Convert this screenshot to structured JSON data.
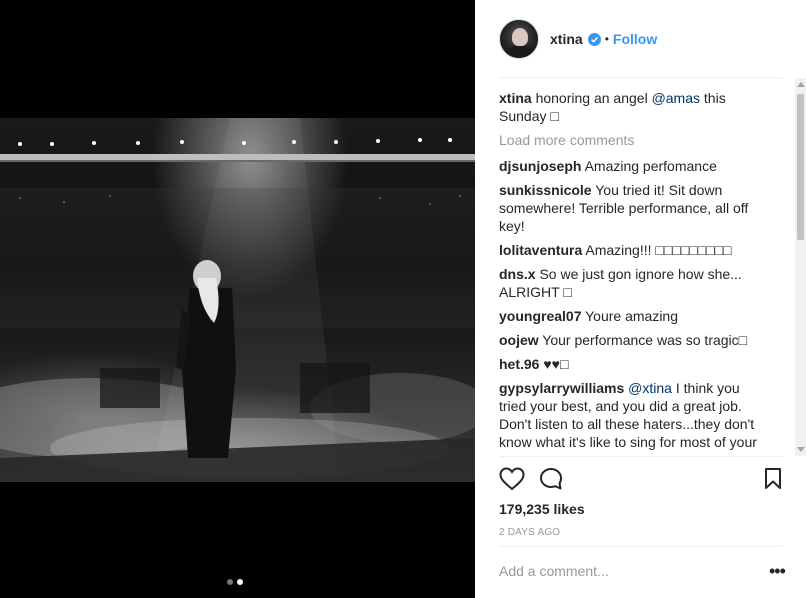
{
  "media": {
    "carousel_count": 2,
    "carousel_active": 2
  },
  "post": {
    "author": "xtina",
    "bullet": "•",
    "follow_label": "Follow",
    "caption_user": "xtina",
    "caption_text_before": " honoring an angel ",
    "caption_mention": "@amas",
    "caption_text_after": " this Sunday ",
    "caption_emoji": "□"
  },
  "comments": {
    "load_more": "Load more comments",
    "items": [
      {
        "user": "djsunjoseph",
        "text": " Amazing perfomance"
      },
      {
        "user": "sunkissnicole",
        "text": " You tried it! Sit down somewhere! Terrible performance, all off key!"
      },
      {
        "user": "lolitaventura",
        "text": " Amazing!!! □□□□□□□□□"
      },
      {
        "user": "dns.x",
        "text": " So we just gon ignore how she... ALRIGHT □"
      },
      {
        "user": "youngreal07",
        "text": " Youre amazing"
      },
      {
        "user": "oojew",
        "text": " Your performance was so tragic□"
      },
      {
        "user": "het.96",
        "text": " ♥♥□"
      },
      {
        "user": "gypsylarrywilliams",
        "mention": " @xtina",
        "text": " I think you tried your best, and you did a great job. Don't listen to all these haters...they don't know what it's like to sing for most of your"
      }
    ]
  },
  "stats": {
    "likes": "179,235 likes",
    "date": "2 DAYS AGO"
  },
  "compose": {
    "placeholder": "Add a comment...",
    "more_label": "•••"
  },
  "colors": {
    "accent": "#3897f0",
    "mention": "#003569",
    "muted": "#999999",
    "text": "#262626"
  },
  "icons": {
    "verified": "verified-badge-icon",
    "like": "heart-icon",
    "comment": "speech-bubble-icon",
    "save": "bookmark-icon",
    "options": "more-options-icon"
  }
}
